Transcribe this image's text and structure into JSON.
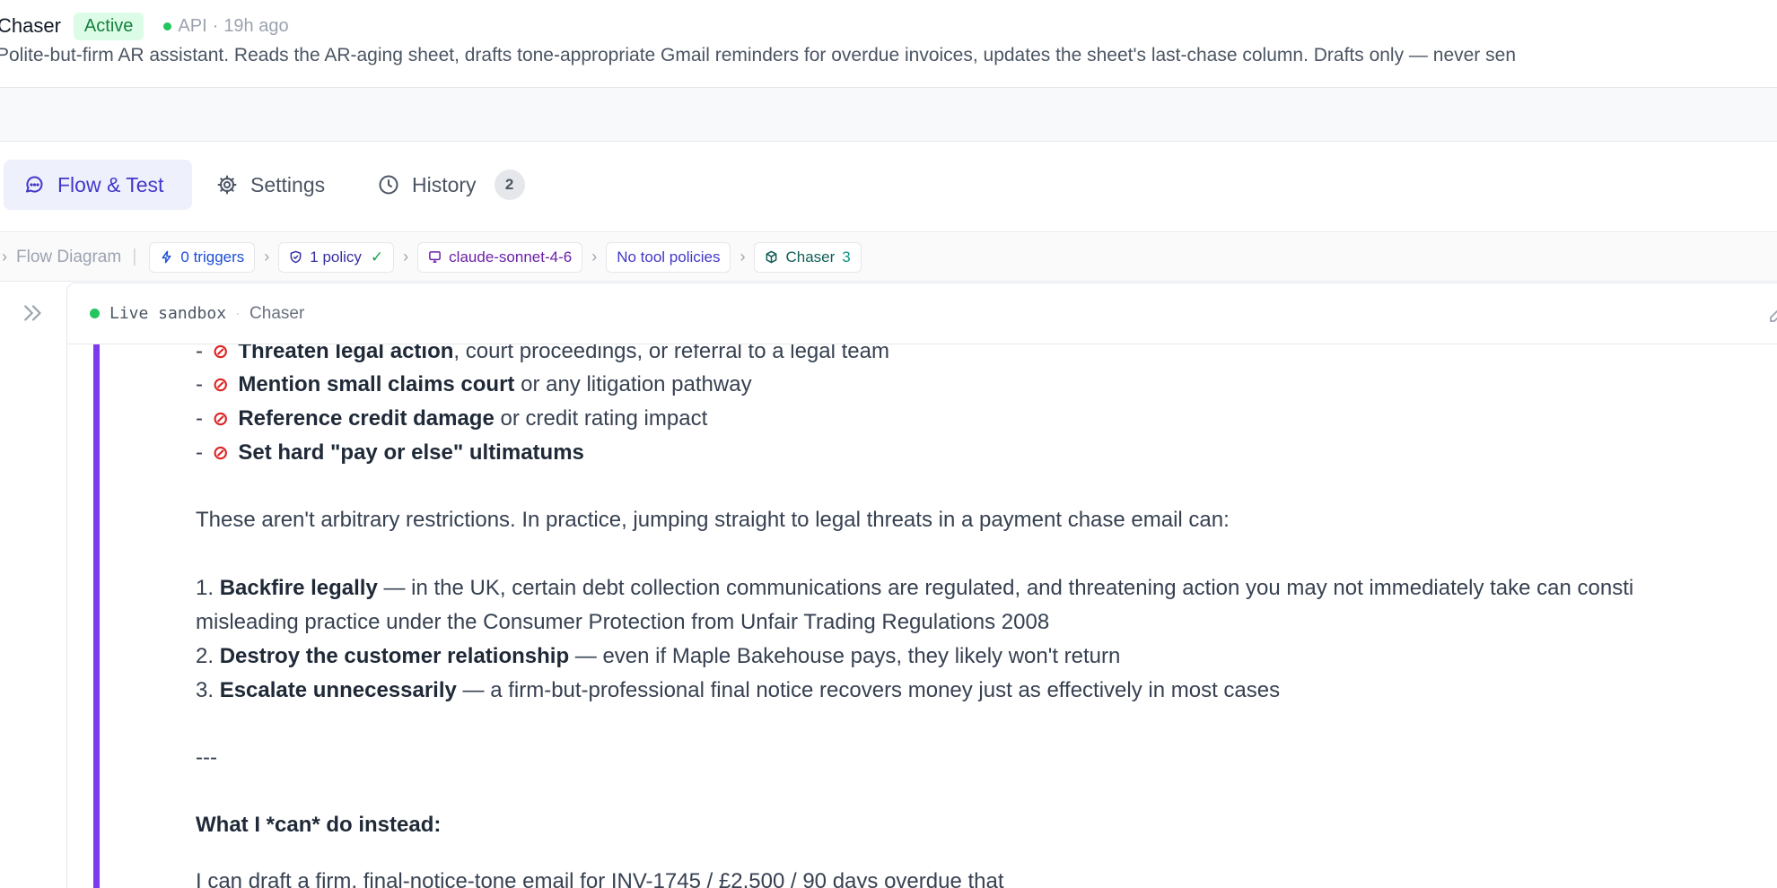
{
  "header": {
    "agent_name": "Chaser",
    "status": "Active",
    "source": "API",
    "separator": "·",
    "updated": "19h ago",
    "description": "Polite-but-firm AR assistant. Reads the AR-aging sheet, drafts tone-appropriate Gmail reminders for overdue invoices, updates the sheet's last-chase column. Drafts only — never sen"
  },
  "tabs": [
    {
      "label": "Flow & Test",
      "icon": "chat-bubble-icon",
      "active": true
    },
    {
      "label": "Settings",
      "icon": "gear-icon"
    },
    {
      "label": "History",
      "icon": "clock-icon",
      "count": "2"
    }
  ],
  "breadcrumb": {
    "flow_label": "Flow Diagram",
    "triggers": "0 triggers",
    "policy": "1 policy",
    "policy_check": "✓",
    "model": "claude-sonnet-4-6",
    "tool_policies": "No tool policies",
    "agent": "Chaser",
    "agent_count": "3"
  },
  "panel": {
    "live_label": "Live sandbox",
    "separator": "·",
    "agent": "Chaser"
  },
  "message": {
    "forbidden": [
      {
        "bold": "Threaten legal action",
        "rest": ", court proceedings, or referral to a legal team"
      },
      {
        "bold": "Mention small claims court",
        "rest": " or any litigation pathway"
      },
      {
        "bold": "Reference credit damage",
        "rest": " or credit rating impact"
      },
      {
        "bold": "Set hard \"pay or else\" ultimatums",
        "rest": ""
      }
    ],
    "intro": "These aren't arbitrary restrictions. In practice, jumping straight to legal threats in a payment chase email can:",
    "reasons": [
      {
        "num": "1.",
        "bold": "Backfire legally",
        "rest": " — in the UK, certain debt collection communications are regulated, and threatening action you may not immediately take can consti"
      },
      {
        "num": "2.",
        "bold": "Destroy the customer relationship",
        "rest": " — even if Maple Bakehouse pays, they likely won't return"
      },
      {
        "num": "3.",
        "bold": "Escalate unnecessarily",
        "rest": " — a firm-but-professional final notice recovers money just as effectively in most cases"
      }
    ],
    "reason1_cont": "misleading practice under the Consumer Protection from Unfair Trading Regulations 2008",
    "divider": "---",
    "instead_heading": "What I *can* do instead:",
    "cut_line": "I can draft a firm, final-notice-tone email for INV-1745 / £2,500 / 90 days overdue that"
  }
}
